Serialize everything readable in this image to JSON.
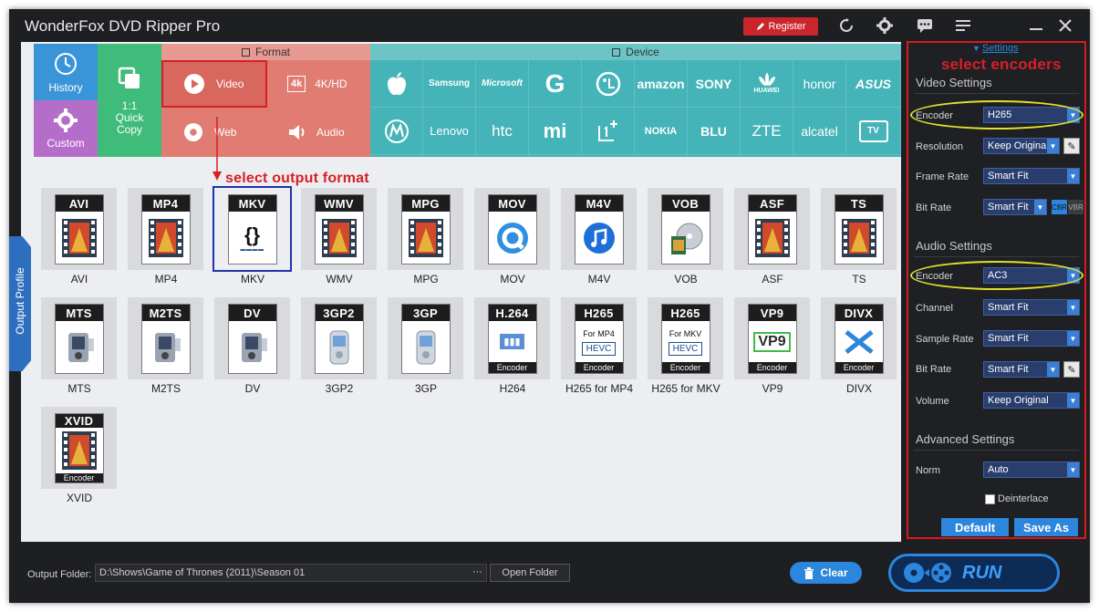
{
  "app": {
    "title": "WonderFox DVD Ripper Pro",
    "register_label": "Register"
  },
  "left_nav": {
    "history_label": "History",
    "custom_label": "Custom",
    "quick_copy_line1": "1:1",
    "quick_copy_line2": "Quick",
    "quick_copy_line3": "Copy"
  },
  "format_section": {
    "header": "Format",
    "video_label": "Video",
    "k4_label": "4K/HD",
    "web_label": "Web",
    "audio_label": "Audio"
  },
  "device_section": {
    "header": "Device",
    "row1": [
      "Samsung",
      "Microsoft",
      "Google",
      "LG",
      "amazon",
      "SONY",
      "HUAWEI",
      "honor",
      "ASUS"
    ],
    "row2": [
      "Motorola",
      "Lenovo",
      "htc",
      "mi",
      "OnePlus",
      "NOKIA",
      "BLU",
      "ZTE",
      "alcatel",
      "TV"
    ]
  },
  "annotations": {
    "select_output_format": "select output format",
    "select_encoders": "select encoders"
  },
  "side_tab": {
    "label": "Output Profile"
  },
  "formats": [
    {
      "name": "AVI",
      "label": "AVI"
    },
    {
      "name": "MP4",
      "label": "MP4"
    },
    {
      "name": "MKV",
      "label": "MKV",
      "selected": true
    },
    {
      "name": "WMV",
      "label": "WMV"
    },
    {
      "name": "MPG",
      "label": "MPG"
    },
    {
      "name": "MOV",
      "label": "MOV"
    },
    {
      "name": "M4V",
      "label": "M4V"
    },
    {
      "name": "VOB",
      "label": "VOB"
    },
    {
      "name": "ASF",
      "label": "ASF"
    },
    {
      "name": "TS",
      "label": "TS"
    },
    {
      "name": "MTS",
      "label": "MTS"
    },
    {
      "name": "M2TS",
      "label": "M2TS"
    },
    {
      "name": "DV",
      "label": "DV"
    },
    {
      "name": "3GP2",
      "label": "3GP2"
    },
    {
      "name": "3GP",
      "label": "3GP"
    },
    {
      "name": "H.264",
      "label": "H264",
      "sub": "Encoder"
    },
    {
      "name": "H265",
      "label": "H265 for MP4",
      "sub": "Encoder",
      "tag": "For MP4",
      "badge": "HEVC"
    },
    {
      "name": "H265",
      "label": "H265 for MKV",
      "sub": "Encoder",
      "tag": "For MKV",
      "badge": "HEVC"
    },
    {
      "name": "VP9",
      "label": "VP9",
      "sub": "Encoder"
    },
    {
      "name": "DIVX",
      "label": "DIVX",
      "sub": "Encoder"
    },
    {
      "name": "XVID",
      "label": "XVID",
      "sub": "Encoder"
    }
  ],
  "settings": {
    "tab_label": "Settings",
    "video_header": "Video Settings",
    "audio_header": "Audio Settings",
    "advanced_header": "Advanced Settings",
    "video": {
      "encoder_label": "Encoder",
      "encoder_value": "H265",
      "resolution_label": "Resolution",
      "resolution_value": "Keep Original",
      "framerate_label": "Frame Rate",
      "framerate_value": "Smart Fit",
      "bitrate_label": "Bit Rate",
      "bitrate_value": "Smart Fit",
      "cbr_label": "CBR",
      "vbr_label": "VBR"
    },
    "audio": {
      "encoder_label": "Encoder",
      "encoder_value": "AC3",
      "channel_label": "Channel",
      "channel_value": "Smart Fit",
      "samplerate_label": "Sample Rate",
      "samplerate_value": "Smart Fit",
      "bitrate_label": "Bit Rate",
      "bitrate_value": "Smart Fit",
      "volume_label": "Volume",
      "volume_value": "Keep Original"
    },
    "advanced": {
      "norm_label": "Norm",
      "norm_value": "Auto",
      "deinterlace_label": "Deinterlace"
    },
    "default_label": "Default",
    "saveas_label": "Save As"
  },
  "bottom": {
    "output_folder_label": "Output Folder:",
    "output_folder_value": "D:\\Shows\\Game of Thrones (2011)\\Season 01",
    "browse_label": "···",
    "open_folder_label": "Open Folder",
    "clear_label": "Clear",
    "run_label": "RUN"
  },
  "colors": {
    "history_bg": "#3a95d8",
    "custom_bg": "#b46ec9",
    "quickcopy_bg": "#3fbb7a",
    "format_bg": "#e07c72",
    "device_bg": "#45b4b8",
    "accent_blue": "#2b86dc",
    "annotation_red": "#d81f26"
  }
}
